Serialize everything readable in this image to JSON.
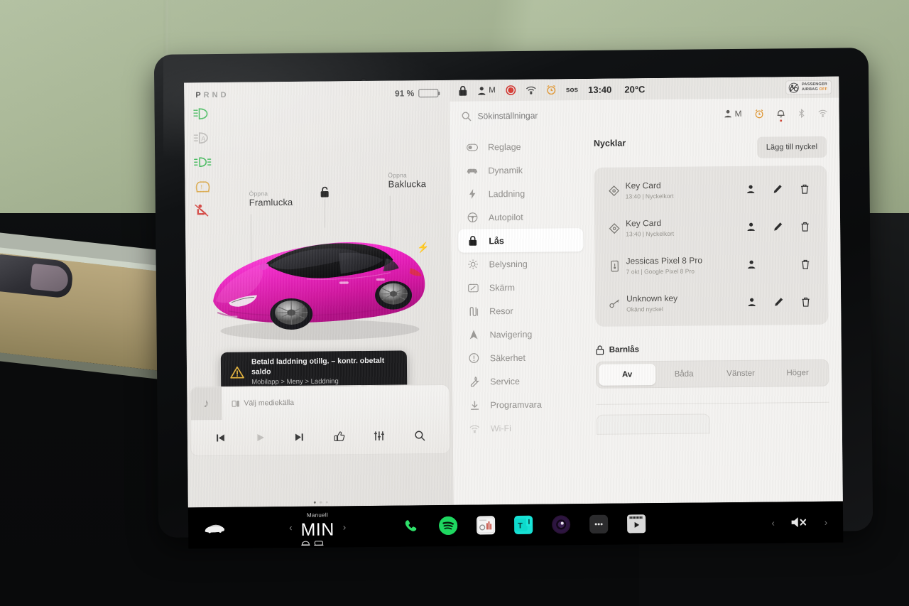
{
  "instrument": {
    "gear_label": "PRND",
    "gear_active": "P",
    "battery_percent": "91 %",
    "battery_level": 91,
    "telltales": [
      {
        "name": "low-beam-headlight",
        "color": "#2fb34a"
      },
      {
        "name": "auto-high-beam",
        "color": "#b5b3b0"
      },
      {
        "name": "front-fog-light",
        "color": "#2fb34a"
      },
      {
        "name": "tire-pressure-warning",
        "color": "#d9a441"
      },
      {
        "name": "seatbelt-warning",
        "color": "#d23a35"
      }
    ]
  },
  "car_view": {
    "front_trunk": {
      "action": "Öppna",
      "label": "Framlucka"
    },
    "rear_trunk": {
      "action": "Öppna",
      "label": "Baklucka"
    },
    "lock_state_icon": "unlocked-padlock-icon",
    "charge_port_icon": "charge-bolt-icon",
    "body_color": "#ef21c8",
    "roof_color": "#171717"
  },
  "alert": {
    "icon": "warning-triangle-icon",
    "title": "Betald laddning otillg. – kontr. obetalt saldo",
    "subtitle": "Mobilapp > Meny > Laddning"
  },
  "media": {
    "source_placeholder": "Välj mediekälla",
    "thumb_icon": "music-note-icon",
    "source_icon": "media-source-icon",
    "controls": [
      {
        "name": "previous-track-button",
        "glyph": "⏮"
      },
      {
        "name": "play-button",
        "glyph": "▶"
      },
      {
        "name": "next-track-button",
        "glyph": "⏭"
      },
      {
        "name": "thumbs-up-button",
        "glyph": "👍"
      },
      {
        "name": "equalizer-button",
        "glyph": "⦀"
      },
      {
        "name": "media-search-button",
        "glyph": "⌕"
      }
    ],
    "page_dots": 3,
    "active_dot": 0
  },
  "statusbar": {
    "lock_icon": "locked-padlock-icon",
    "driver_profile": "M",
    "recording_icon": "sentry-record-icon",
    "wifi_icon": "wifi-icon",
    "alarm_icon": "alarm-clock-icon",
    "sos_label": "sos",
    "time": "13:40",
    "temperature": "20°C",
    "airbag_line1": "PASSENGER",
    "airbag_line2": "AIRBAG",
    "airbag_state": "OFF"
  },
  "search": {
    "placeholder": "Sökinställningar",
    "icon": "search-icon",
    "right_icons": [
      {
        "name": "driver-profile-icon",
        "label": "M"
      },
      {
        "name": "alarm-clock-icon",
        "label": ""
      },
      {
        "name": "notification-bell-icon",
        "label": ""
      },
      {
        "name": "bluetooth-icon",
        "label": ""
      },
      {
        "name": "wifi-icon",
        "label": ""
      }
    ]
  },
  "sidebar": {
    "items": [
      {
        "label": "Reglage",
        "icon": "toggle-icon",
        "active": false,
        "faded": false
      },
      {
        "label": "Dynamik",
        "icon": "car-icon",
        "active": false,
        "faded": false
      },
      {
        "label": "Laddning",
        "icon": "bolt-icon",
        "active": false,
        "faded": false
      },
      {
        "label": "Autopilot",
        "icon": "steering-wheel-icon",
        "active": false,
        "faded": false
      },
      {
        "label": "Lås",
        "icon": "lock-icon",
        "active": true,
        "faded": false
      },
      {
        "label": "Belysning",
        "icon": "brightness-icon",
        "active": false,
        "faded": false
      },
      {
        "label": "Skärm",
        "icon": "display-icon",
        "active": false,
        "faded": false
      },
      {
        "label": "Resor",
        "icon": "trips-icon",
        "active": false,
        "faded": false
      },
      {
        "label": "Navigering",
        "icon": "navigation-arrow-icon",
        "active": false,
        "faded": false
      },
      {
        "label": "Säkerhet",
        "icon": "safety-alert-icon",
        "active": false,
        "faded": false
      },
      {
        "label": "Service",
        "icon": "wrench-icon",
        "active": false,
        "faded": false
      },
      {
        "label": "Programvara",
        "icon": "download-icon",
        "active": false,
        "faded": false
      },
      {
        "label": "Wi-Fi",
        "icon": "wifi-icon",
        "active": false,
        "faded": true
      }
    ]
  },
  "keys": {
    "section_title": "Nycklar",
    "add_button": "Lägg till nyckel",
    "rows": [
      {
        "icon": "key-card-icon",
        "name": "Key Card",
        "sub": "13:40 | Nyckelkort",
        "actions": [
          {
            "name": "assign-driver-button",
            "glyph": "👤",
            "visible": true
          },
          {
            "name": "edit-key-button",
            "glyph": "✎",
            "visible": true
          },
          {
            "name": "delete-key-button",
            "glyph": "🗑",
            "visible": true
          }
        ]
      },
      {
        "icon": "key-card-icon",
        "name": "Key Card",
        "sub": "13:40 | Nyckelkort",
        "actions": [
          {
            "name": "assign-driver-button",
            "glyph": "👤",
            "visible": true
          },
          {
            "name": "edit-key-button",
            "glyph": "✎",
            "visible": true
          },
          {
            "name": "delete-key-button",
            "glyph": "🗑",
            "visible": true
          }
        ]
      },
      {
        "icon": "phone-key-icon",
        "name": "Jessicas Pixel 8 Pro",
        "sub": "7 okt | Google Pixel 8 Pro",
        "actions": [
          {
            "name": "assign-driver-button",
            "glyph": "👤",
            "visible": true
          },
          {
            "name": "edit-key-button",
            "glyph": "✎",
            "visible": false
          },
          {
            "name": "delete-key-button",
            "glyph": "🗑",
            "visible": true
          }
        ]
      },
      {
        "icon": "key-fob-icon",
        "name": "Unknown key",
        "sub": "Okänd nyckel",
        "actions": [
          {
            "name": "assign-driver-button",
            "glyph": "👤",
            "visible": true
          },
          {
            "name": "edit-key-button",
            "glyph": "✎",
            "visible": true
          },
          {
            "name": "delete-key-button",
            "glyph": "🗑",
            "visible": true
          }
        ]
      }
    ]
  },
  "child_lock": {
    "icon": "child-lock-icon",
    "title": "Barnlås",
    "options": [
      "Av",
      "Båda",
      "Vänster",
      "Höger"
    ],
    "selected": "Av"
  },
  "dock": {
    "car_icon": "car-front-icon",
    "climate": {
      "mode": "Manuell",
      "temperature": "MIN",
      "vents_icon": "seat-vents-icon",
      "prev_icon": "chevron-left-icon",
      "next_icon": "chevron-right-icon"
    },
    "apps": [
      {
        "name": "phone-app",
        "glyph": "✆"
      },
      {
        "name": "spotify-app",
        "glyph": "♫"
      },
      {
        "name": "radio-app",
        "glyph": ""
      },
      {
        "name": "toybox-app",
        "glyph": "T"
      },
      {
        "name": "dashcam-app",
        "glyph": ""
      },
      {
        "name": "more-apps-button",
        "glyph": "•••"
      },
      {
        "name": "theater-app",
        "glyph": "▶"
      }
    ],
    "volume": {
      "icon": "volume-muted-icon",
      "prev": "‹",
      "next": "›"
    }
  },
  "colors": {
    "accent_green": "#2fb34a",
    "amber": "#e0952f",
    "red": "#d23a35",
    "car_pink": "#ef21c8",
    "spotify_green": "#1ed760",
    "screen_bg": "#f2f1ef"
  }
}
